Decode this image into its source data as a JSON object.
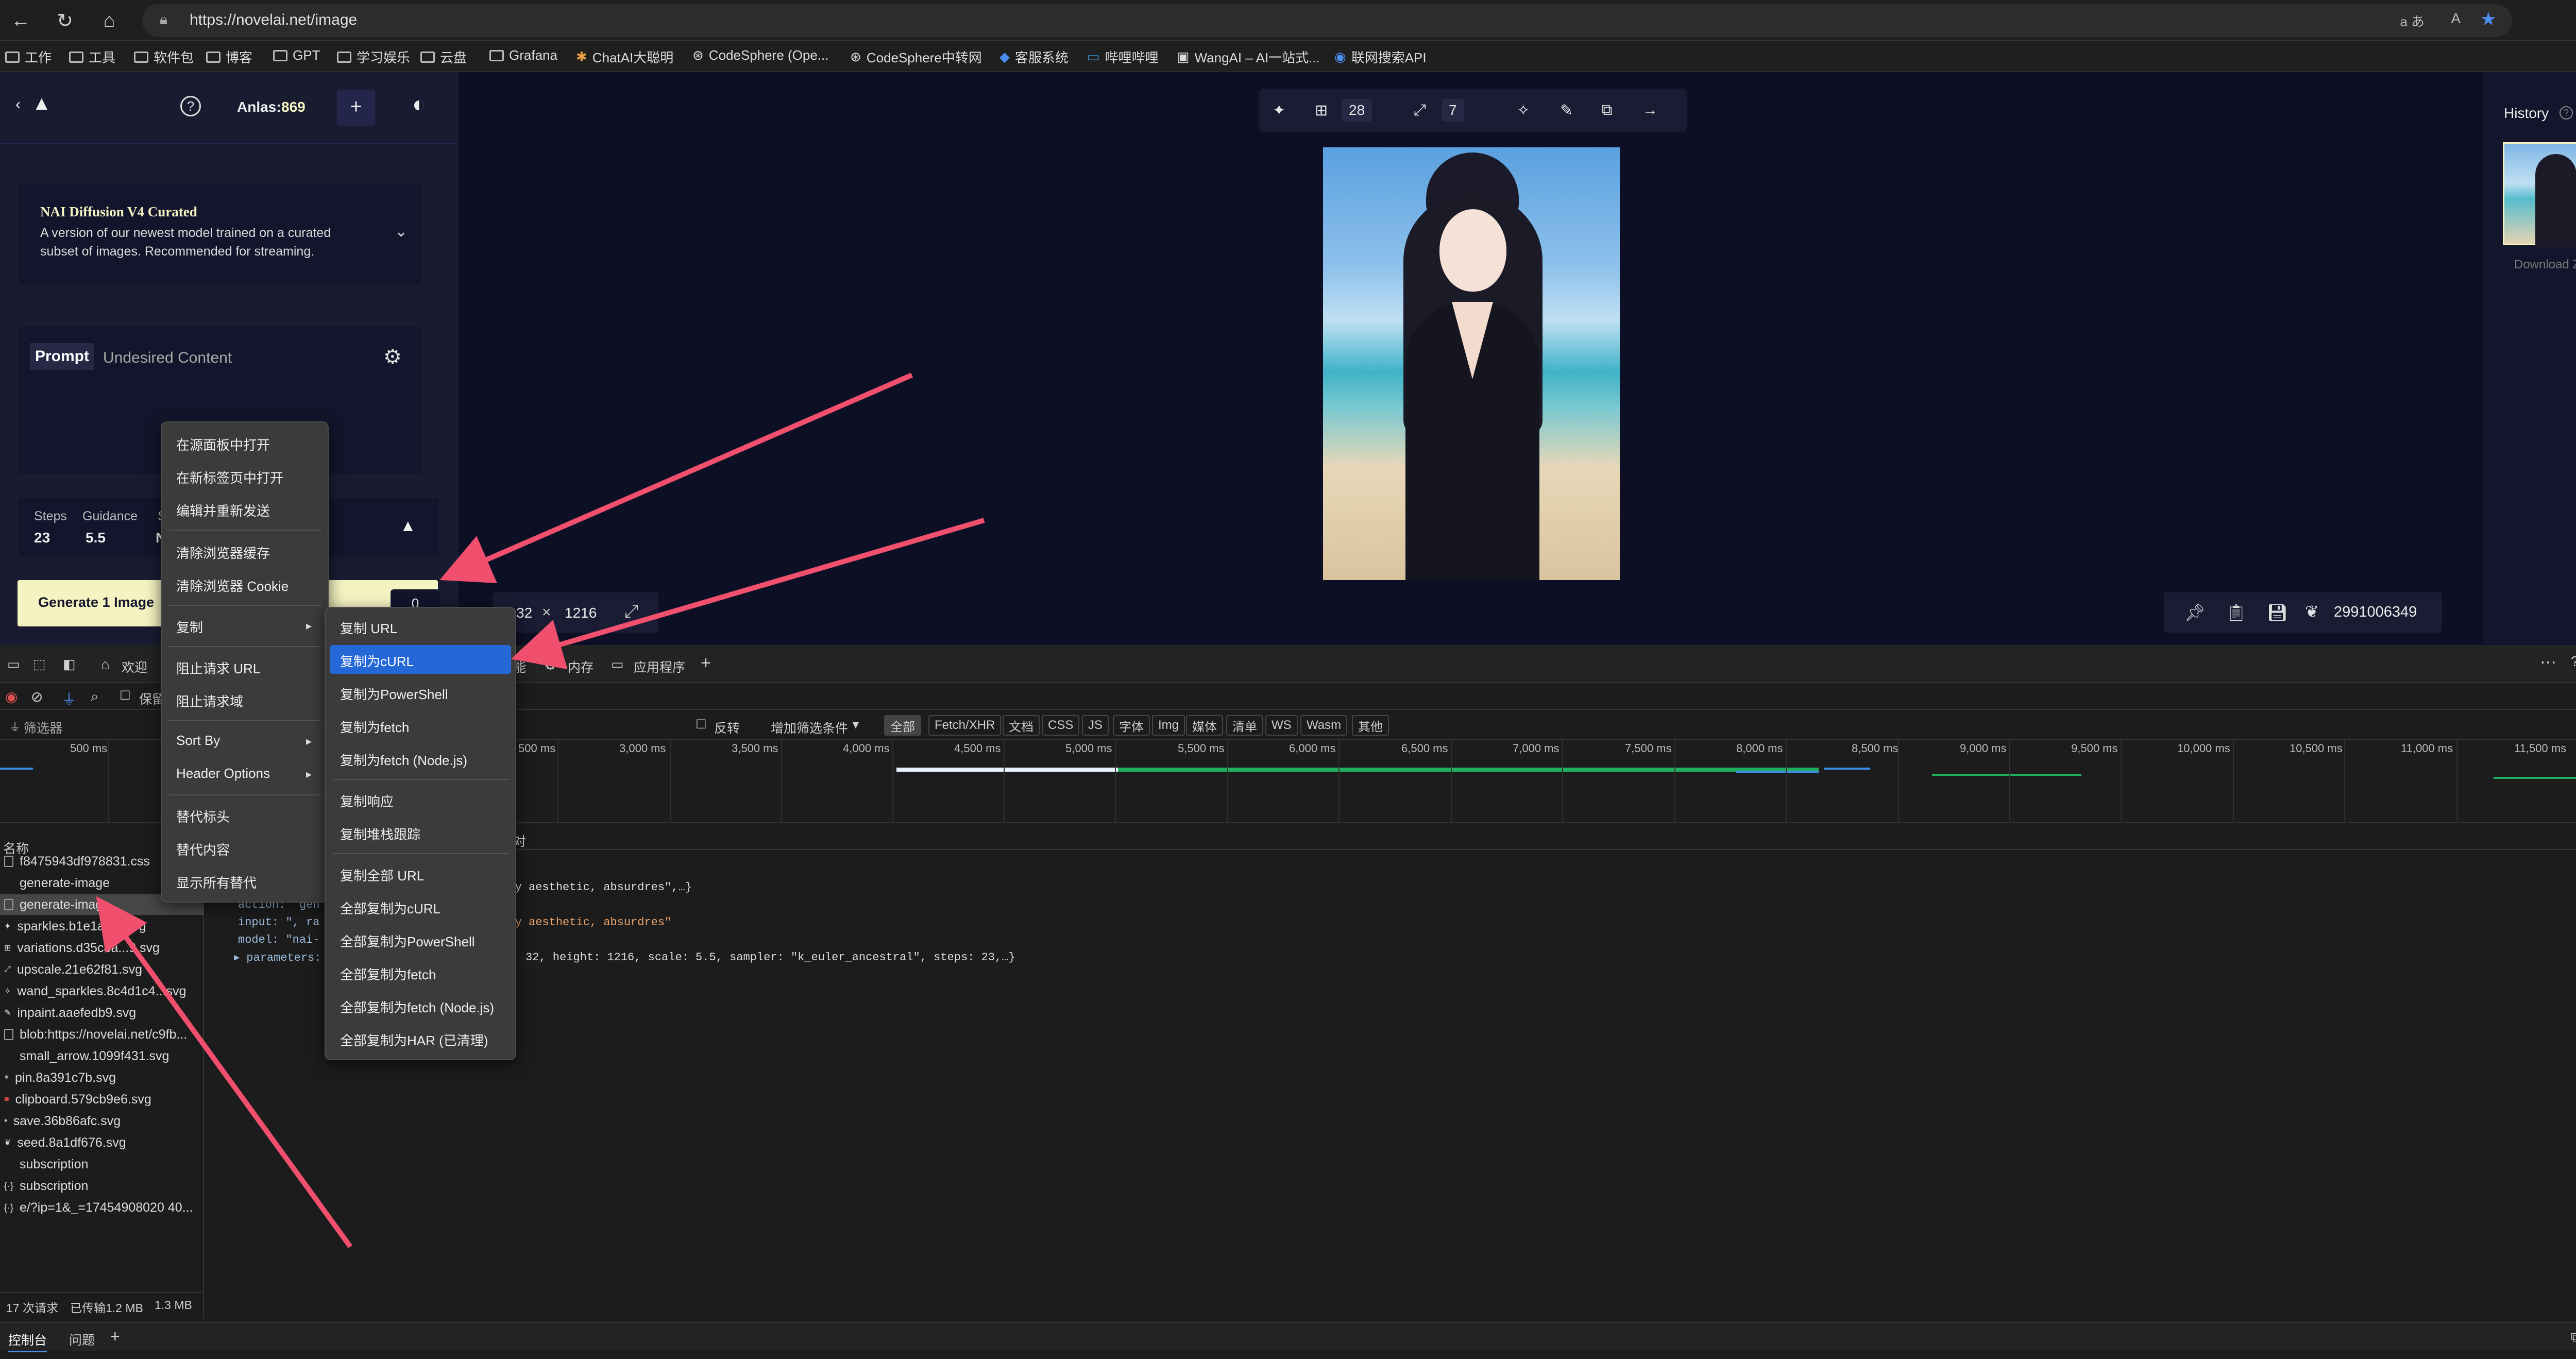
{
  "browser": {
    "url": "https://novelai.net/image",
    "bookmarks": [
      "工作",
      "工具",
      "软件包",
      "博客",
      "GPT",
      "学习娱乐",
      "云盘",
      "Grafana",
      "ChatAI大聪明",
      "CodeSphere (Ope...",
      "CodeSphere中转网",
      "客服系统",
      "哔哩哔哩",
      "WangAI – AI一站式...",
      "联网搜索API"
    ],
    "right_icons": [
      "read-aloud-icon",
      "font-icon",
      "favorite-star-icon",
      "more-icon"
    ]
  },
  "app": {
    "anlas_label": "Anlas:",
    "anlas_value": "869",
    "model_title": "NAI Diffusion V4 Curated",
    "model_desc_1": "A version of our newest model trained on a curated",
    "model_desc_2": "subset of images. Recommended for streaming.",
    "prompt_tab": "Prompt",
    "undesired_tab": "Undesired Content",
    "steps_label": "Steps",
    "steps_value": "23",
    "guidance_label": "Guidance",
    "guidance_value": "5.5",
    "sampler_label_partial": "S",
    "sampler_value_partial": "N",
    "generate_label": "Generate 1 Image",
    "generate_cost": "0",
    "toolbar_steps": "28",
    "toolbar_upscale": "7",
    "width_partial": "32",
    "times": "×",
    "height": "1216",
    "seed": "2991006349",
    "history_label": "History",
    "download_zip": "Download ZIP"
  },
  "devtools": {
    "tabs": [
      "欢迎",
      "能",
      "内存",
      "应用程序"
    ],
    "filter_placeholder": "筛选器",
    "invert_label": "反转",
    "more_filters": "增加筛选条件",
    "preserve_partial": "保留",
    "filter_types": [
      "全部",
      "Fetch/XHR",
      "文档",
      "CSS",
      "JS",
      "字体",
      "Img",
      "媒体",
      "清单",
      "WS",
      "Wasm",
      "其他"
    ],
    "timeline_ticks": [
      "500 ms",
      "500 ms",
      "3,000 ms",
      "3,500 ms",
      "4,000 ms",
      "4,500 ms",
      "5,000 ms",
      "5,500 ms",
      "6,000 ms",
      "6,500 ms",
      "7,000 ms",
      "7,500 ms",
      "8,000 ms",
      "8,500 ms",
      "9,000 ms",
      "9,500 ms",
      "10,000 ms",
      "10,500 ms",
      "11,000 ms",
      "11,500 ms"
    ],
    "name_header": "名称",
    "requests": [
      "f8475943df978831.css",
      "generate-image",
      "generate-image",
      "sparkles.b1e1a...0.svg",
      "variations.d35c8a...9.svg",
      "upscale.21e62f81.svg",
      "wand_sparkles.8c4d1c4...svg",
      "inpaint.aaefedb9.svg",
      "blob:https://novelai.net/c9fb...",
      "small_arrow.1099f431.svg",
      "pin.8a391c7b.svg",
      "clipboard.579cb9e6.svg",
      "save.36b86afc.svg",
      "seed.8a1df676.svg",
      "subscription",
      "subscription",
      "e/?ip=1&_=17454908020 40..."
    ],
    "payload_line1": "very aesthetic, absurdres\",…}",
    "payload_action": "action: \"gen",
    "payload_input": "input: \", ra",
    "payload_input_tail": "very aesthetic, absurdres\"",
    "payload_model": "model: \"nai-",
    "payload_params": "parameters:",
    "payload_params_tail": "32, height: 1216, scale: 5.5, sampler: \"k_euler_ancestral\", steps: 23,…}",
    "header_partial": "对",
    "status": [
      "17 次请求",
      "已传输1.2 MB",
      "1.3 MB"
    ],
    "drawer_tabs": [
      "控制台",
      "问题"
    ]
  },
  "context_menu": {
    "items": [
      "在源面板中打开",
      "在新标签页中打开",
      "编辑并重新发送",
      "清除浏览器缓存",
      "清除浏览器 Cookie",
      "复制",
      "阻止请求 URL",
      "阻止请求域",
      "Sort By",
      "Header Options",
      "替代标头",
      "替代内容",
      "显示所有替代"
    ]
  },
  "copy_submenu": {
    "items": [
      "复制 URL",
      "复制为cURL",
      "复制为PowerShell",
      "复制为fetch",
      "复制为fetch (Node.js)",
      "复制响应",
      "复制堆栈跟踪",
      "复制全部 URL",
      "全部复制为cURL",
      "全部复制为PowerShell",
      "全部复制为fetch",
      "全部复制为fetch (Node.js)",
      "全部复制为HAR (已清理)"
    ],
    "highlighted": "复制为cURL"
  },
  "colors": {
    "app_bg": "#13152c",
    "accent_yellow": "#f5f3c2",
    "menu_bg": "#3b3b3b",
    "highlight": "#2468d8",
    "annotation_arrow": "#f0506e"
  }
}
